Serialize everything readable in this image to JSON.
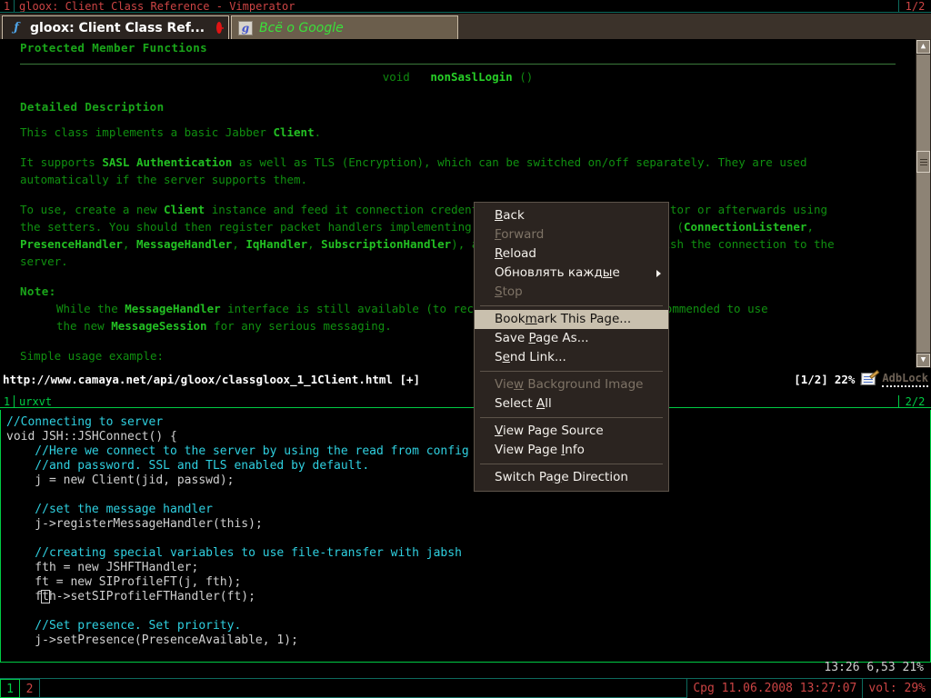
{
  "browser_window": {
    "titlebar": {
      "workspace_number": "1",
      "caption": "gloox: Client Class Reference - Vimperator",
      "pager": "1/2"
    },
    "tabs": [
      {
        "title": "gloox: Client Class Ref...",
        "favicon": "firefox-icon",
        "active": true,
        "close_label": "×"
      },
      {
        "title": "Всё о Google",
        "favicon": "google-icon",
        "active": false
      }
    ],
    "statusline": {
      "url": "http://www.camaya.net/api/gloox/classgloox_1_1Client.html [+]",
      "pagecount": "[1/2]",
      "zoom": "22%",
      "note_icon": "notepad-pencil-icon",
      "adblock": "AdbLock"
    },
    "scrollbar": {
      "up_glyph": "▲",
      "down_glyph": "▼"
    }
  },
  "page": {
    "section_heading": "Protected Member Functions",
    "signature": {
      "return_type": "void",
      "name": "nonSaslLogin",
      "args": "()"
    },
    "detailed_heading": "Detailed Description",
    "para1_a": "This class implements a basic Jabber ",
    "para1_b": "Client",
    "para1_c": ".",
    "para2_a": "It supports ",
    "para2_b": "SASL Authentication",
    "para2_c": " as well as TLS (Encryption), which can be switched on/off separately. They are used",
    "para2_d": "automatically if the server supports them.",
    "para3_a": "To use, create a new ",
    "para3_b": "Client",
    "para3_c": " instance and feed it connection credentials, either in the constructor or afterwards using",
    "para3_d": "the setters. You should then register packet handlers implementing the corresponding Interfaces (",
    "para3_e": "ConnectionListener",
    "para3_f": ",",
    "para3_g1": "PresenceHandler",
    "para3_g2": ", ",
    "para3_g3": "MessageHandler",
    "para3_g4": ", ",
    "para3_g5": "IqHandler",
    "para3_g6": ", ",
    "para3_g7": "SubscriptionHandler",
    "para3_g8": "), and call connect() to establish the connection to the",
    "para3_h": "server.",
    "note_label": "Note:",
    "note_line1_a": "While the ",
    "note_line1_b": "MessageHandler",
    "note_line1_c": " interface is still available (to receive Messages) it is now recommended to use",
    "note_line2_a": "the new ",
    "note_line2_b": "MessageSession",
    "note_line2_c": " for any serious messaging.",
    "usage_label": "Simple usage example:"
  },
  "context_menu": {
    "items": [
      {
        "label": "Back",
        "accel": "B",
        "state": "normal"
      },
      {
        "label": "Forward",
        "accel": "F",
        "state": "disabled"
      },
      {
        "label": "Reload",
        "accel": "R",
        "state": "normal"
      },
      {
        "label": "Обновлять каждые",
        "accel": "ы",
        "state": "submenu"
      },
      {
        "label": "Stop",
        "accel": "S",
        "state": "disabled"
      },
      {
        "separator": true
      },
      {
        "label": "Bookmark This Page...",
        "accel": "m",
        "state": "selected"
      },
      {
        "label": "Save Page As...",
        "accel": "P",
        "state": "normal"
      },
      {
        "label": "Send Link...",
        "accel": "e",
        "state": "normal"
      },
      {
        "separator": true
      },
      {
        "label": "View Background Image",
        "accel": "w",
        "state": "disabled"
      },
      {
        "label": "Select All",
        "accel": "A",
        "state": "normal"
      },
      {
        "separator": true
      },
      {
        "label": "View Page Source",
        "accel": "V",
        "state": "normal"
      },
      {
        "label": "View Page Info",
        "accel": "I",
        "state": "normal"
      },
      {
        "separator": true
      },
      {
        "label": "Switch Page Direction",
        "accel": "g",
        "state": "normal"
      }
    ]
  },
  "terminal_window": {
    "titlebar": {
      "workspace_number": "1",
      "caption": "urxvt",
      "pager": "2/2"
    },
    "lines": [
      {
        "type": "comment",
        "text": "//Connecting to server"
      },
      {
        "type": "plain",
        "text": "void JSH::JSHConnect() {"
      },
      {
        "type": "comment",
        "text": "    //Here we connect to the server by using the read from config jid,"
      },
      {
        "type": "comment",
        "text": "    //and password. SSL and TLS enabled by default."
      },
      {
        "type": "mixed",
        "text": "    j = new Client(jid, passwd);",
        "keyword": "new"
      },
      {
        "type": "blank",
        "text": ""
      },
      {
        "type": "comment",
        "text": "    //set the message handler"
      },
      {
        "type": "mixed",
        "text": "    j->registerMessageHandler(this);",
        "keyword": "this"
      },
      {
        "type": "blank",
        "text": ""
      },
      {
        "type": "comment",
        "text": "    //creating special variables to use file-transfer with jabsh"
      },
      {
        "type": "mixed",
        "text": "    fth = new JSHFTHandler;",
        "keyword": "new"
      },
      {
        "type": "mixed",
        "text": "    ft = new SIProfileFT(j, fth);",
        "keyword": "new"
      },
      {
        "type": "cursor",
        "text": "    fth->setSIProfileFTHandler(ft);",
        "cursor_char": "t"
      },
      {
        "type": "blank",
        "text": ""
      },
      {
        "type": "comment",
        "text": "    //Set presence. Set priority."
      },
      {
        "type": "mixed",
        "text": "    j->setPresence(PresenceAvailable, 1);",
        "keyword": "1"
      }
    ],
    "clock": "13:26 6,53 21%"
  },
  "bottom_bar": {
    "workspaces": [
      {
        "label": "1",
        "active": true
      },
      {
        "label": "2",
        "active": false
      }
    ],
    "datetime": "Cpg 11.06.2008 13:27:07",
    "volume": "vol: 29%"
  }
}
